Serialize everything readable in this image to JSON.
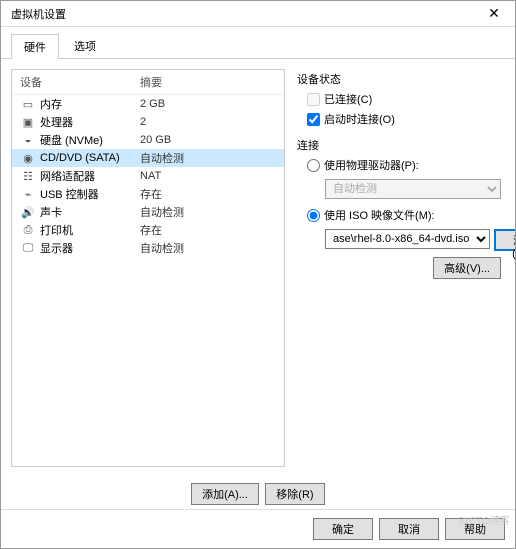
{
  "dialog": {
    "title": "虚拟机设置",
    "close_icon": "✕"
  },
  "tabs": {
    "hardware": "硬件",
    "options": "选项"
  },
  "hw_header": {
    "device": "设备",
    "summary": "摘要"
  },
  "hardware": [
    {
      "icon": "▭",
      "name": "内存",
      "summary": "2 GB"
    },
    {
      "icon": "▣",
      "name": "处理器",
      "summary": "2"
    },
    {
      "icon": "◒",
      "name": "硬盘 (NVMe)",
      "summary": "20 GB"
    },
    {
      "icon": "◉",
      "name": "CD/DVD (SATA)",
      "summary": "自动检测"
    },
    {
      "icon": "☷",
      "name": "网络适配器",
      "summary": "NAT"
    },
    {
      "icon": "⌁",
      "name": "USB 控制器",
      "summary": "存在"
    },
    {
      "icon": "🔊",
      "name": "声卡",
      "summary": "自动检测"
    },
    {
      "icon": "⎙",
      "name": "打印机",
      "summary": "存在"
    },
    {
      "icon": "🖵",
      "name": "显示器",
      "summary": "自动检测"
    }
  ],
  "device_status": {
    "group_label": "设备状态",
    "connected_label": "已连接(C)",
    "connect_at_power_label": "启动时连接(O)"
  },
  "connection": {
    "group_label": "连接",
    "physical_label": "使用物理驱动器(P):",
    "physical_option": "自动检测",
    "iso_label": "使用 ISO 映像文件(M):",
    "iso_value": "ase\\rhel-8.0-x86_64-dvd.iso",
    "browse_label": "浏览(B)..."
  },
  "advanced_label": "高级(V)...",
  "buttons": {
    "add": "添加(A)...",
    "remove": "移除(R)",
    "ok": "确定",
    "cancel": "取消",
    "help": "帮助"
  },
  "watermark": "51CTO博客"
}
